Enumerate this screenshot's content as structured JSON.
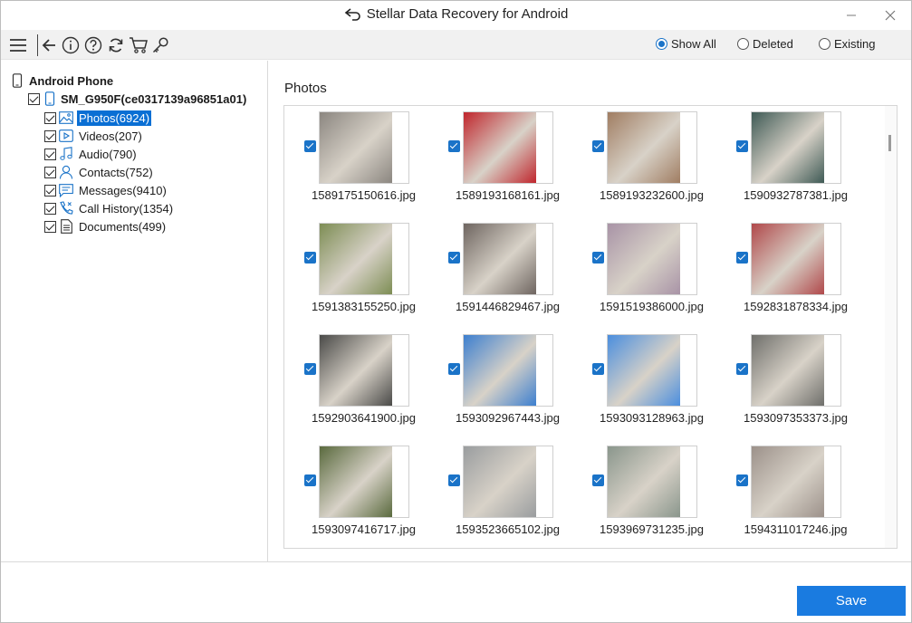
{
  "window": {
    "title": "Stellar Data Recovery for Android",
    "minimize_glyph": "—",
    "close_glyph": "✕"
  },
  "toolbar": {
    "icons": [
      "menu-icon",
      "back-icon",
      "info-icon",
      "help-icon",
      "refresh-icon",
      "cart-icon",
      "key-icon"
    ],
    "filters": [
      {
        "label": "Show All",
        "selected": true
      },
      {
        "label": "Deleted",
        "selected": false
      },
      {
        "label": "Existing",
        "selected": false
      }
    ]
  },
  "tree": {
    "root_label": "Android Phone",
    "device_label": "SM_G950F(ce0317139a96851a01)",
    "items": [
      {
        "label": "Photos(6924)",
        "icon": "photo-icon",
        "selected": true
      },
      {
        "label": "Videos(207)",
        "icon": "video-icon",
        "selected": false
      },
      {
        "label": "Audio(790)",
        "icon": "music-icon",
        "selected": false
      },
      {
        "label": "Contacts(752)",
        "icon": "contact-icon",
        "selected": false
      },
      {
        "label": "Messages(9410)",
        "icon": "message-icon",
        "selected": false
      },
      {
        "label": "Call History(1354)",
        "icon": "call-icon",
        "selected": false
      },
      {
        "label": "Documents(499)",
        "icon": "document-icon",
        "selected": false
      }
    ]
  },
  "content": {
    "section_title": "Photos",
    "photos": [
      {
        "name": "1589175150616.jpg",
        "color": "#8b8680"
      },
      {
        "name": "1589193168161.jpg",
        "color": "#c0262d"
      },
      {
        "name": "1589193232600.jpg",
        "color": "#a07d62"
      },
      {
        "name": "1590932787381.jpg",
        "color": "#3f5a55"
      },
      {
        "name": "1591383155250.jpg",
        "color": "#7d8d54"
      },
      {
        "name": "1591446829467.jpg",
        "color": "#6e6560"
      },
      {
        "name": "1591519386000.jpg",
        "color": "#a893a6"
      },
      {
        "name": "1592831878334.jpg",
        "color": "#b0484a"
      },
      {
        "name": "1592903641900.jpg",
        "color": "#4a4a48"
      },
      {
        "name": "1593092967443.jpg",
        "color": "#3d7fcf"
      },
      {
        "name": "1593093128963.jpg",
        "color": "#4b8ede"
      },
      {
        "name": "1593097353373.jpg",
        "color": "#6f6f6b"
      },
      {
        "name": "1593097416717.jpg",
        "color": "#5a6a3e"
      },
      {
        "name": "1593523665102.jpg",
        "color": "#9a9d9f"
      },
      {
        "name": "1593969731235.jpg",
        "color": "#8a968c"
      },
      {
        "name": "1594311017246.jpg",
        "color": "#9c918a"
      }
    ]
  },
  "footer": {
    "save_label": "Save"
  },
  "colors": {
    "accent": "#1a7be0",
    "selection": "#0a6fd4",
    "toolbar_bg": "#f1f1f1"
  }
}
